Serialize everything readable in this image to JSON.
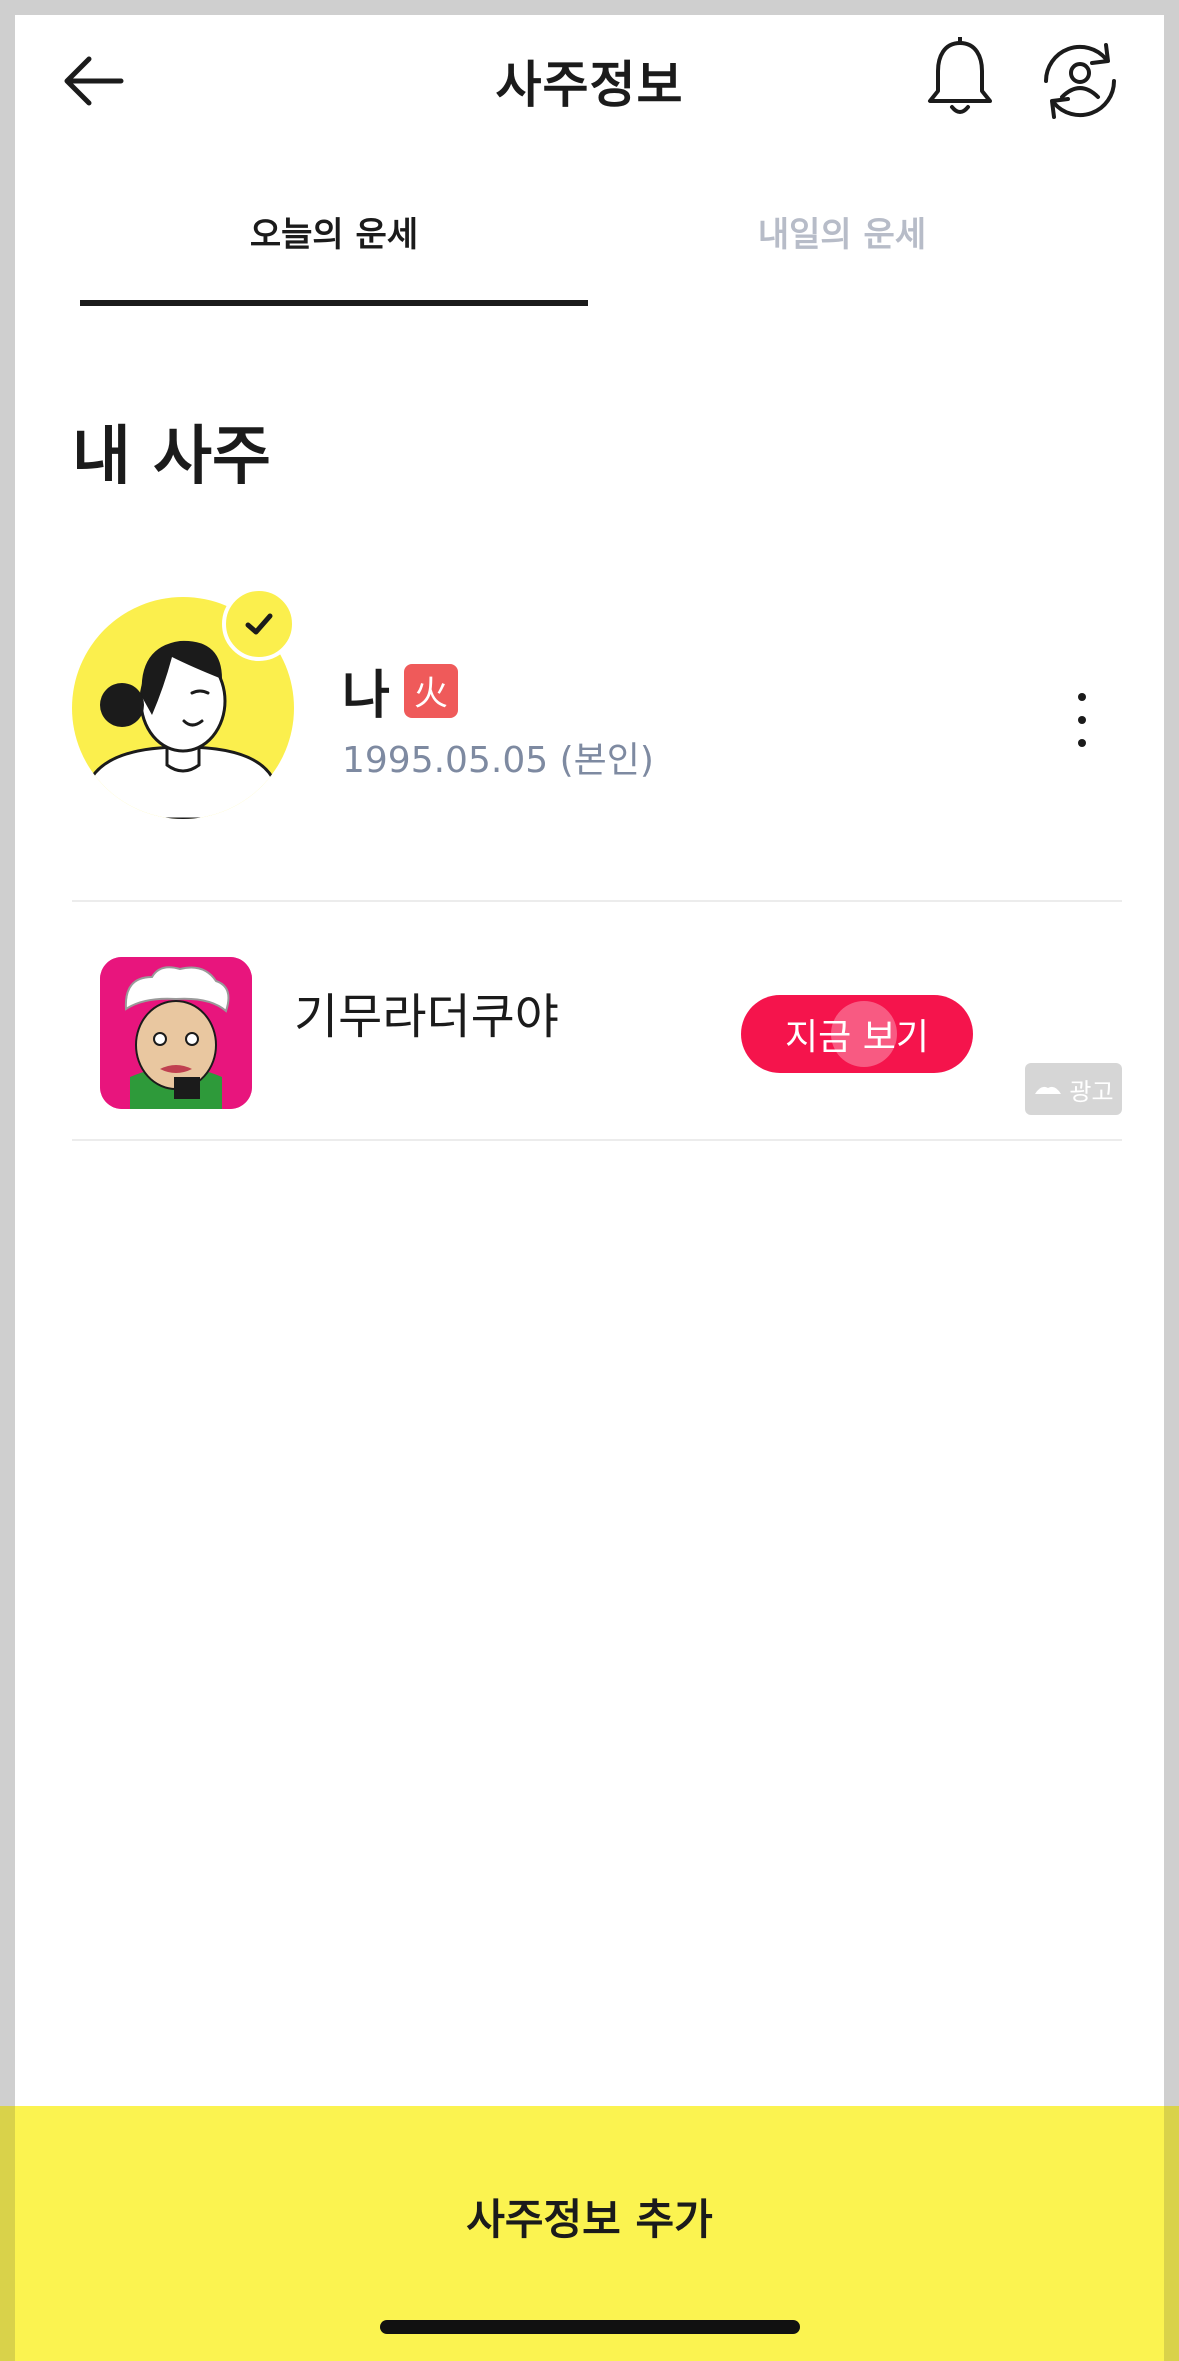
{
  "header": {
    "title": "사주정보",
    "back_icon": "arrow-left-icon",
    "bell_icon": "bell-icon",
    "profile_switch_icon": "profile-switch-icon"
  },
  "tabs": [
    {
      "label": "오늘의 운세",
      "active": true
    },
    {
      "label": "내일의 운세",
      "active": false
    }
  ],
  "section": {
    "title": "내 사주"
  },
  "my_saju": {
    "name": "나",
    "element": "火",
    "birth": "1995.05.05 (본인)"
  },
  "ad": {
    "title": "기무라더쿠야",
    "cta": "지금 보기",
    "badge": "광고"
  },
  "bottom": {
    "add_label": "사주정보 추가"
  },
  "colors": {
    "accent_yellow": "#fbef4d",
    "cta_red": "#f5144c",
    "fire_badge": "#ef5a5a",
    "muted_text": "#7e8aa1"
  }
}
